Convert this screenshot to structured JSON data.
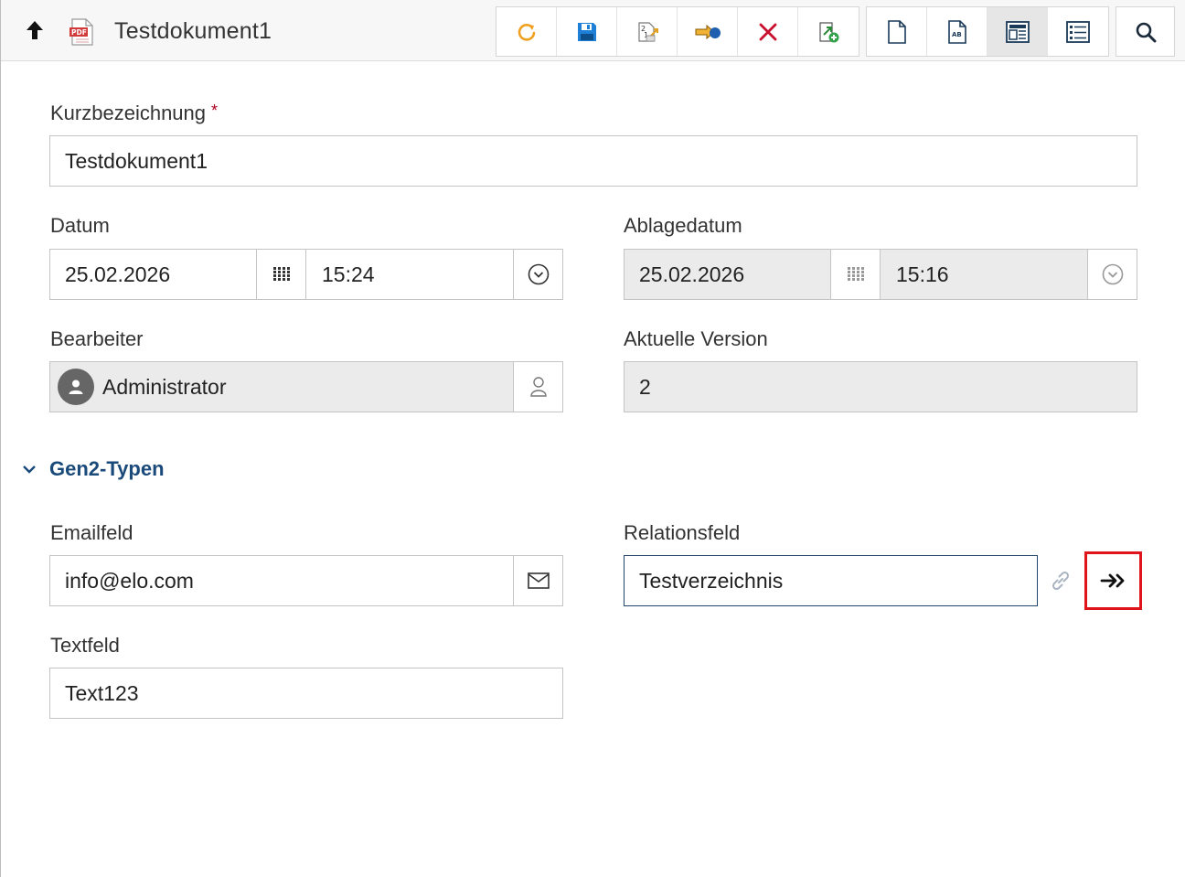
{
  "header": {
    "title": "Testdokument1",
    "file_type": "PDF"
  },
  "toolbar": {
    "group1": [
      "refresh-icon",
      "save-icon",
      "renumber-icon",
      "forward-icon",
      "delete-icon",
      "new-version-icon"
    ],
    "group2": [
      "document-view-icon",
      "text-view-icon",
      "form-view-icon",
      "list-view-icon"
    ],
    "group3": [
      "search-icon"
    ]
  },
  "form": {
    "kurzbezeichnung": {
      "label": "Kurzbezeichnung",
      "required_mark": "*",
      "value": "Testdokument1"
    },
    "datum": {
      "label": "Datum",
      "date": "25.02.2026",
      "time": "15:24"
    },
    "ablagedatum": {
      "label": "Ablagedatum",
      "date": "25.02.2026",
      "time": "15:16"
    },
    "bearbeiter": {
      "label": "Bearbeiter",
      "value": "Administrator"
    },
    "aktuelle_version": {
      "label": "Aktuelle Version",
      "value": "2"
    },
    "section": {
      "title": "Gen2-Typen"
    },
    "emailfeld": {
      "label": "Emailfeld",
      "value": "info@elo.com"
    },
    "relationsfeld": {
      "label": "Relationsfeld",
      "value": "Testverzeichnis"
    },
    "textfeld": {
      "label": "Textfeld",
      "value": "Text123"
    }
  },
  "colors": {
    "accent": "#1a4a7a",
    "highlight": "#e0151b",
    "readonly_bg": "#ebebeb"
  }
}
